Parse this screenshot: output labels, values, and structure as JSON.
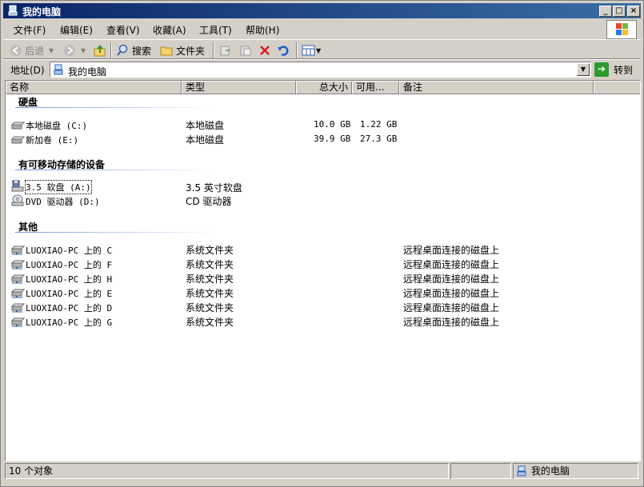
{
  "window": {
    "title": "我的电脑"
  },
  "menu": [
    {
      "label": "文件(F)"
    },
    {
      "label": "编辑(E)"
    },
    {
      "label": "查看(V)"
    },
    {
      "label": "收藏(A)"
    },
    {
      "label": "工具(T)"
    },
    {
      "label": "帮助(H)"
    }
  ],
  "toolbar": {
    "back_label": "后退",
    "search_label": "搜索",
    "folders_label": "文件夹"
  },
  "address": {
    "label": "地址(D)",
    "value": "我的电脑",
    "goto_label": "转到"
  },
  "columns": {
    "name": "名称",
    "type": "类型",
    "total": "总大小",
    "free": "可用...",
    "comment": "备注"
  },
  "groups": {
    "hard_disks": {
      "title": "硬盘",
      "items": [
        {
          "name": "本地磁盘 (C:)",
          "type": "本地磁盘",
          "total": "10.0 GB",
          "free": "1.22 GB",
          "comment": "",
          "icon": "hard-drive-icon"
        },
        {
          "name": "新加卷 (E:)",
          "type": "本地磁盘",
          "total": "39.9 GB",
          "free": "27.3 GB",
          "comment": "",
          "icon": "hard-drive-icon"
        }
      ]
    },
    "removable": {
      "title": "有可移动存储的设备",
      "items": [
        {
          "name": "3.5 软盘 (A:)",
          "type": "3.5 英寸软盘",
          "total": "",
          "free": "",
          "comment": "",
          "icon": "floppy-drive-icon"
        },
        {
          "name": "DVD 驱动器 (D:)",
          "type": "CD 驱动器",
          "total": "",
          "free": "",
          "comment": "",
          "icon": "dvd-drive-icon"
        }
      ]
    },
    "other": {
      "title": "其他",
      "items": [
        {
          "name": "LUOXIAO-PC 上的 C",
          "type": "系统文件夹",
          "comment": "远程桌面连接的磁盘上",
          "icon": "network-drive-icon"
        },
        {
          "name": "LUOXIAO-PC 上的 F",
          "type": "系统文件夹",
          "comment": "远程桌面连接的磁盘上",
          "icon": "network-drive-icon"
        },
        {
          "name": "LUOXIAO-PC 上的 H",
          "type": "系统文件夹",
          "comment": "远程桌面连接的磁盘上",
          "icon": "network-drive-icon"
        },
        {
          "name": "LUOXIAO-PC 上的 E",
          "type": "系统文件夹",
          "comment": "远程桌面连接的磁盘上",
          "icon": "network-drive-icon"
        },
        {
          "name": "LUOXIAO-PC 上的 D",
          "type": "系统文件夹",
          "comment": "远程桌面连接的磁盘上",
          "icon": "network-drive-icon"
        },
        {
          "name": "LUOXIAO-PC 上的 G",
          "type": "系统文件夹",
          "comment": "远程桌面连接的磁盘上",
          "icon": "network-drive-icon"
        }
      ]
    }
  },
  "status": {
    "count": "10 个对象",
    "location": "我的电脑"
  }
}
